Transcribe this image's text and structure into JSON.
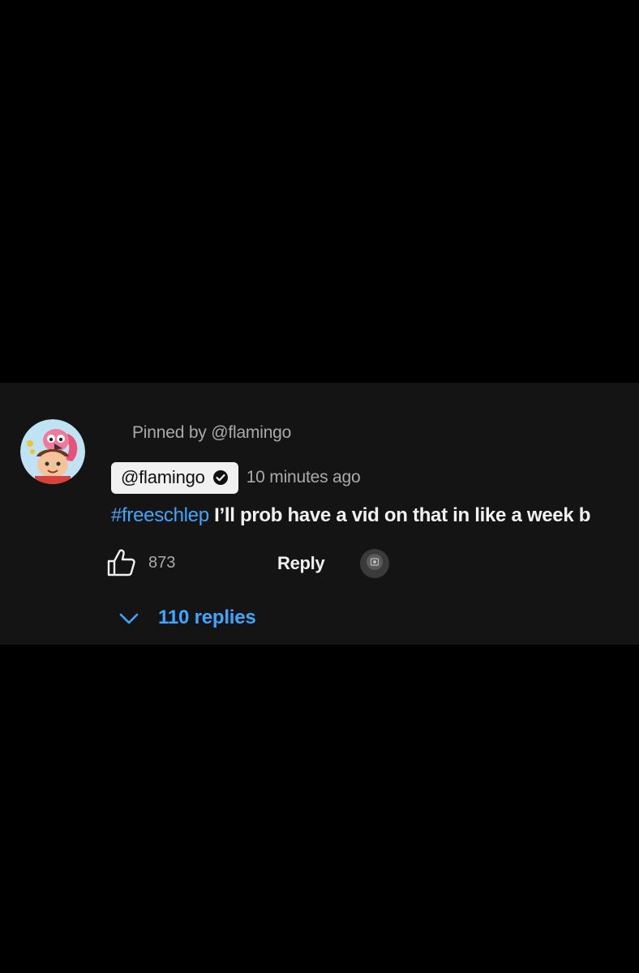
{
  "comment": {
    "pinned_label": "Pinned by @flamingo",
    "author": "@flamingo",
    "author_verified_icon": "verified-check-icon",
    "timestamp": "10 minutes ago",
    "hashtag": "#freeschlep",
    "text": " I’ll prob have a vid on that in like a week b",
    "like_count": "873",
    "reply_label": "Reply",
    "replies_label": "110 replies"
  },
  "icons": {
    "pin": "pin-icon",
    "like": "thumbs-up-icon",
    "expand": "chevron-down-icon",
    "creator_heart": "creator-heart-avatar-icon"
  },
  "colors": {
    "background": "#000000",
    "panel": "#141414",
    "link_blue": "#3ea6ff",
    "text_primary": "#f1f1f1",
    "text_secondary": "#aaaaaa",
    "author_chip": "#f1f1f1"
  }
}
